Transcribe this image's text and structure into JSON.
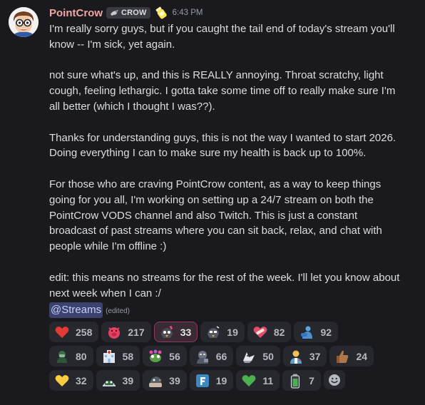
{
  "author": {
    "name": "PointCrow",
    "tag": "CROW",
    "badge_icon": "pill-bottle-emoji"
  },
  "timestamp": "6:43 PM",
  "message": {
    "paragraphs": [
      "I'm really sorry guys, but if you caught the tail end of today's stream you'll know -- I'm sick, yet again.",
      "not sure what's up, and this is REALLY annoying. Throat scratchy, light cough, feeling lethargic. I gotta take some time off to really make sure I'm all better (which I thought I was??).",
      "Thanks for understanding guys, this is not the way I wanted to start 2026. Doing everything I can to make sure my health is back up to 100%.",
      "For those who are craving PointCrow content, as a way to keep things going for you all, I'm working on setting up a 24/7 stream on both the PointCrow VODS channel and also Twitch. This is just a constant broadcast of past streams where you can sit back, relax, and chat with people while I'm offline :)",
      "edit: this means no streams for the rest of the week. I'll let you know about next week when I can :/"
    ],
    "mention": "@Streams",
    "edited_label": "(edited)"
  },
  "reactions": [
    {
      "emoji": "red-heart",
      "count": "258",
      "active": false
    },
    {
      "emoji": "sick-pig",
      "count": "217",
      "active": false
    },
    {
      "emoji": "crow-sick",
      "count": "33",
      "active": true
    },
    {
      "emoji": "crow-sick-2",
      "count": "19",
      "active": false
    },
    {
      "emoji": "heart-bandage",
      "count": "82",
      "active": false
    },
    {
      "emoji": "blue-hug",
      "count": "92",
      "active": false
    },
    {
      "emoji": "green-mask",
      "count": "80",
      "active": false
    },
    {
      "emoji": "hospital",
      "count": "58",
      "active": false
    },
    {
      "emoji": "pepe-flowers",
      "count": "56",
      "active": false
    },
    {
      "emoji": "gray-sick",
      "count": "66",
      "active": false
    },
    {
      "emoji": "crow-bird",
      "count": "50",
      "active": false
    },
    {
      "emoji": "health-worker",
      "count": "37",
      "active": false
    },
    {
      "emoji": "thumbs-up",
      "count": "24",
      "active": false
    },
    {
      "emoji": "yellow-heart",
      "count": "32",
      "active": false
    },
    {
      "emoji": "frog-blanket",
      "count": "39",
      "active": false
    },
    {
      "emoji": "crow-blanket",
      "count": "39",
      "active": false
    },
    {
      "emoji": "letter-f",
      "count": "19",
      "active": false
    },
    {
      "emoji": "green-heart",
      "count": "11",
      "active": false
    },
    {
      "emoji": "battery",
      "count": "7",
      "active": false
    }
  ],
  "colors": {
    "username": "#f0a5a3",
    "mention_bg": "#3c4270",
    "active_border": "#8b3b5e"
  }
}
